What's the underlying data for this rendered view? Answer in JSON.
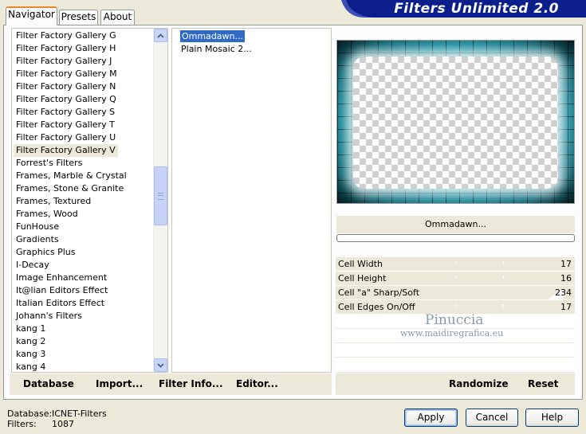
{
  "tabs": [
    "Navigator",
    "Presets",
    "About"
  ],
  "app_title": "Filters Unlimited 2.0",
  "categories": [
    "Filter Factory Gallery G",
    "Filter Factory Gallery H",
    "Filter Factory Gallery J",
    "Filter Factory Gallery M",
    "Filter Factory Gallery N",
    "Filter Factory Gallery Q",
    "Filter Factory Gallery S",
    "Filter Factory Gallery T",
    "Filter Factory Gallery U",
    "Filter Factory Gallery V",
    "Forrest's Filters",
    "Frames, Marble & Crystal",
    "Frames, Stone & Granite",
    "Frames, Textured",
    "Frames, Wood",
    "FunHouse",
    "Gradients",
    "Graphics Plus",
    "I-Decay",
    "Image Enhancement",
    "It@lian Editors Effect",
    "Italian Editors Effect",
    "Johann's Filters",
    "kang 1",
    "kang 2",
    "kang 3",
    "kang 4"
  ],
  "selected_category": "Filter Factory Gallery V",
  "filters": [
    "Ommadawn...",
    "Plain Mosaic 2..."
  ],
  "selected_filter": "Ommadawn...",
  "left_buttons": {
    "database": "Database",
    "import": "Import...",
    "filter_info": "Filter Info...",
    "editor": "Editor..."
  },
  "right_buttons": {
    "randomize": "Randomize",
    "reset": "Reset"
  },
  "filter_name": "Ommadawn...",
  "progress": 0,
  "params": [
    {
      "label": "Cell Width",
      "value": "17"
    },
    {
      "label": "Cell Height",
      "value": "16"
    },
    {
      "label": "Cell \"a\" Sharp/Soft",
      "value": "234"
    },
    {
      "label": "Cell Edges On/Off",
      "value": "17"
    }
  ],
  "watermark": {
    "name": "Pinuccia",
    "url": "www.maidiregrafica.eu"
  },
  "status": {
    "database_label": "Database:",
    "database_value": "ICNET-Filters",
    "filters_label": "Filters:",
    "filters_value": "1087"
  },
  "dialog_buttons": {
    "apply": "Apply",
    "cancel": "Cancel",
    "help": "Help"
  },
  "colors": {
    "selection": "#316ac5",
    "banner": "#0b1f8c",
    "tab_accent": "#e68b2c",
    "preview_cyan": "#3ec0d3"
  }
}
